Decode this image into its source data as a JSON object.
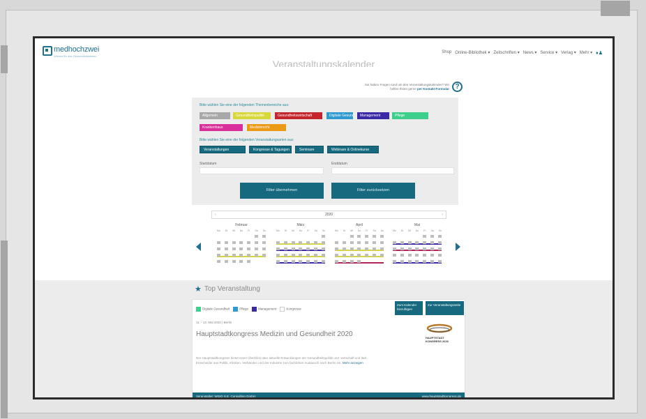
{
  "nav": {
    "logo": "medhochzwei",
    "logo_sub": "Wissen für das Gesundheitswesen",
    "items": [
      "Shop",
      "Online-Bibliothek ▾",
      "Zeitschriften ▾",
      "News ▾",
      "Service ▾",
      "Verlag ▾",
      "Mehr ▾"
    ]
  },
  "page_title": "Veranstaltungskalender",
  "help": {
    "text": "Sie haben Fragen rund um den Veranstaltungskalender? Wir helfen Ihnen gerne ",
    "link": "per Kontakt-Formular"
  },
  "filter": {
    "theme_label": "Bitte wählen Sie eine der folgenden Themenbereiche aus:",
    "themes": [
      {
        "label": "Allgemein",
        "color": "#a8a8a8"
      },
      {
        "label": "Gesundheitspolitik",
        "color": "#d8d83a"
      },
      {
        "label": "Gesundheitswirtschaft",
        "color": "#c5252c"
      },
      {
        "label": "Digitale Gesundheit",
        "color": "#2f9ad0"
      },
      {
        "label": "Management",
        "color": "#3a2aa6"
      },
      {
        "label": "Pflege",
        "color": "#3ecf8c"
      },
      {
        "label": "Krankenhaus",
        "color": "#d82f9a"
      },
      {
        "label": "Medizinrecht",
        "color": "#eb9a18"
      }
    ],
    "type_label": "Bitte wählen Sie eine der folgenden Veranstaltungsarten aus:",
    "types": [
      "Veranstaltungen",
      "Kongresse & Tagungen",
      "Seminare",
      "Webinare & Onlinekurse"
    ],
    "from_label": "Startdatum",
    "to_label": "Enddatum",
    "apply_btn": "Filter übernehmen",
    "reset_btn": "Filter zurücksetzen"
  },
  "calendar": {
    "year": "2020",
    "prev": "‹",
    "next": "›",
    "weekdays": [
      "Mo",
      "Di",
      "Mi",
      "Do",
      "Fr",
      "Sa",
      "So"
    ],
    "months": [
      "Februar",
      "März",
      "April",
      "Mai"
    ]
  },
  "top_event": {
    "heading": "Top Veranstaltung",
    "legend": [
      {
        "label": "Digitale Gesundheit",
        "color": "#3ecf8c"
      },
      {
        "label": "Pflege",
        "color": "#2f9ad0"
      },
      {
        "label": "Management",
        "color": "#3a2aa6"
      },
      {
        "label": "Kongresse",
        "color": "#ffffff"
      }
    ],
    "btn1": "Zum Kalender hinzufügen",
    "btn2": "Zur Veranstaltungsseite",
    "date": "11. - 13. Mai 2020 | Berlin",
    "title": "Hauptstadtkongress Medizin und Gesundheit 2020",
    "desc": "Der Hauptstadtkongress bietet einen Überblick über aktuelle Entwicklungen der Gesundheitspolitik und -wirtschaft und lädt Entscheider aus Politik, Kliniken, Verbänden und der Industrie zum fachlichen Austausch nach Berlin ein. ",
    "more": "Mehr anzeigen",
    "logo_text": "HAUPTSTADT KONGRESS 2020",
    "organizer": "Veranstalter: WISO S.E. Consulting GmbH",
    "url": "www.hauptstadtkongress.de"
  }
}
